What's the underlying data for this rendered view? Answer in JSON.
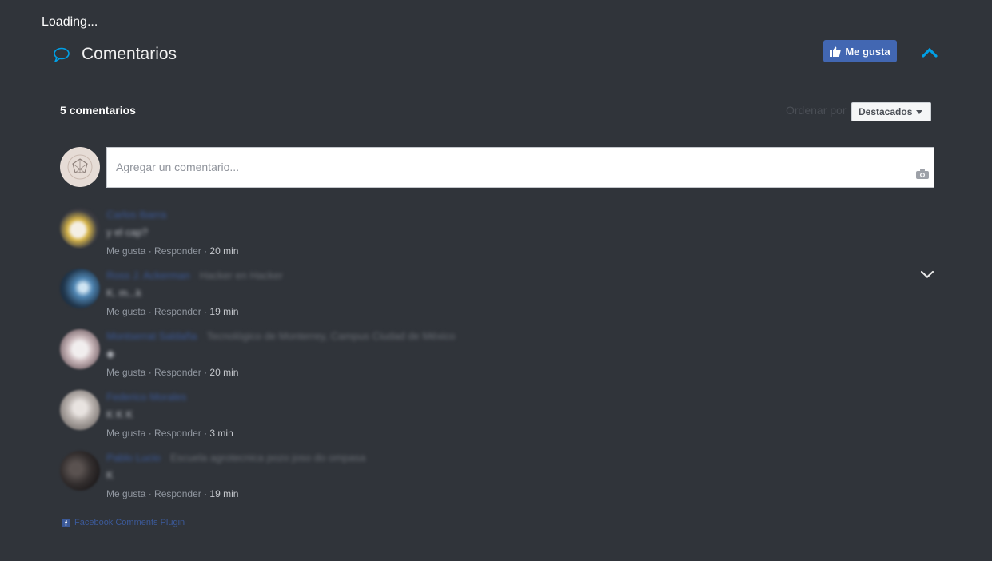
{
  "loading_text": "Loading...",
  "header": {
    "title": "Comentarios",
    "like_label": "Me gusta"
  },
  "toolbar": {
    "count": "5 comentarios",
    "sort_label": "Ordenar por",
    "sort_value": "Destacados"
  },
  "composer": {
    "placeholder": "Agregar un comentario..."
  },
  "comments": [
    {
      "name": "Carlos Ibarra",
      "affiliation": "",
      "text": "y el cap?",
      "like": "Me gusta",
      "reply": "Responder",
      "time": "20 min"
    },
    {
      "name": "Ross J. Ackerman",
      "affiliation": "Hacker en Hacker",
      "text": "K. m...k",
      "like": "Me gusta",
      "reply": "Responder",
      "time": "19 min"
    },
    {
      "name": "Montserrat Saldaña",
      "affiliation": "Tecnológico de Monterrey, Campus Ciudad de México",
      "text": "◆",
      "like": "Me gusta",
      "reply": "Responder",
      "time": "20 min"
    },
    {
      "name": "Federico Morales",
      "affiliation": "",
      "text": "K K K",
      "like": "Me gusta",
      "reply": "Responder",
      "time": "3 min"
    },
    {
      "name": "Pablo Lucio",
      "affiliation": "Escuela agrotecnica pozo joso do ompasa",
      "text": "K",
      "like": "Me gusta",
      "reply": "Responder",
      "time": "19 min"
    }
  ],
  "footer": {
    "plugin_label": "Facebook Comments Plugin"
  },
  "colors": {
    "background": "#30343a",
    "accent": "#00a0e6",
    "facebook_blue": "#4267b2",
    "link": "#3b5998"
  }
}
